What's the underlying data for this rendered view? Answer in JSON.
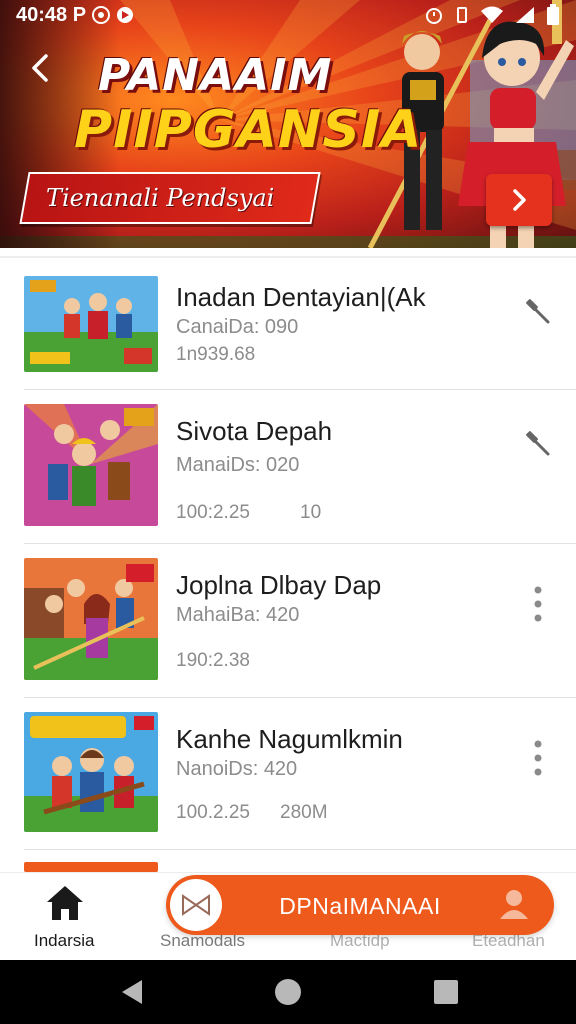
{
  "status_bar": {
    "time": "40:48 P"
  },
  "banner": {
    "title_line1": "PANAAIM",
    "title_line2": "PIIPGANSIA",
    "ribbon_text": "Tienanali Pendsyai"
  },
  "games": [
    {
      "title": "Inadan Dentayian|(Ak",
      "subtitle": "CanaiDa: 090",
      "meta": "1n939.68",
      "meta2": "",
      "action_icon": "hammer-icon"
    },
    {
      "title": "Sivota Depah",
      "subtitle": "ManaiDs: 020",
      "meta": "100:2.25",
      "meta2": "10",
      "action_icon": "hammer-icon"
    },
    {
      "title": "Joplna Dlbay Dap",
      "subtitle": "MahaiBa: 420",
      "meta": "190:2.38",
      "meta2": "",
      "action_icon": "more-vertical-icon"
    },
    {
      "title": "Kanhe Nagumlkmin",
      "subtitle": "NanoiDs: 420",
      "meta": "100.2.25",
      "meta2": "280M",
      "action_icon": "more-vertical-icon"
    }
  ],
  "bottom_nav": {
    "items": [
      {
        "label": "Indarsia",
        "icon": "home-icon",
        "active": true
      },
      {
        "label": "Snamodals",
        "icon": "",
        "active": false
      },
      {
        "label": "Mactidp",
        "icon": "",
        "active": false
      },
      {
        "label": "Eteadhan",
        "icon": "",
        "active": false
      }
    ],
    "cta_label": "DPNaIMANAAI"
  },
  "colors": {
    "accent_orange": "#ee5a1c",
    "banner_red": "#e5321e",
    "title_yellow": "#ffd21a",
    "text_dark": "#1e1e1e",
    "text_muted": "#8c8c8c"
  }
}
